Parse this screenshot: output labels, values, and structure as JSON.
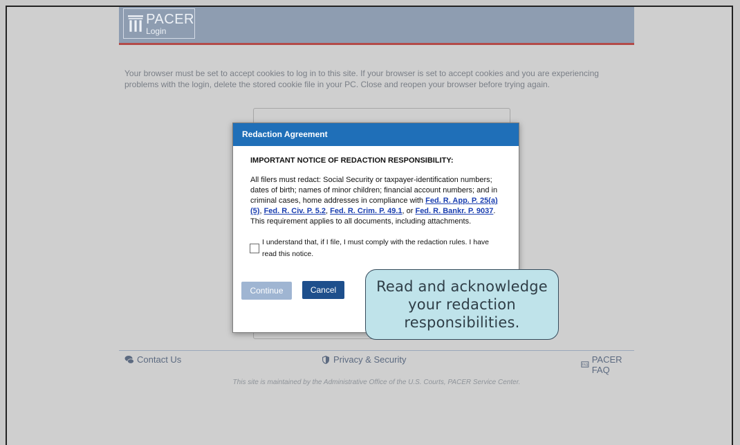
{
  "header": {
    "logo_title": "PACER",
    "logo_subtitle": "Login"
  },
  "main": {
    "cookie_notice": "Your browser must be set to accept cookies to log in to this site. If your browser is set to accept cookies and you are experiencing problems with the login, delete the stored cookie file in your PC. Close and reopen your browser before trying again."
  },
  "modal": {
    "title": "Redaction Agreement",
    "heading": "IMPORTANT NOTICE OF REDACTION RESPONSIBILITY:",
    "body_prefix": "All filers must redact: Social Security or taxpayer-identification numbers; dates of birth; names of minor children; financial account numbers; and in criminal cases, home addresses in compliance with ",
    "links": [
      "Fed. R. App. P. 25(a)(5)",
      "Fed. R. Civ. P. 5.2",
      "Fed. R. Crim. P. 49.1",
      "Fed. R. Bankr. P. 9037"
    ],
    "sep_comma": ", ",
    "sep_or": ", or ",
    "body_suffix": ". This requirement applies to all documents, including attachments.",
    "checkbox_label": "I understand that, if I file, I must comply with the redaction rules. I have read this notice.",
    "checkbox_checked": false,
    "continue_label": "Continue",
    "continue_enabled": false,
    "cancel_label": "Cancel"
  },
  "callout": {
    "text": "Read and acknowledge your redaction responsibilities."
  },
  "footer": {
    "contact_label": "Contact Us",
    "privacy_label": "Privacy & Security",
    "faq_label": "PACER FAQ",
    "maintained_note": "This site is maintained by the Administrative Office of the U.S. Courts, PACER Service Center."
  },
  "colors": {
    "modal_header": "#1f6fb8",
    "header_bar": "#8e9db1",
    "callout_bg": "#bfe3ea",
    "link": "#1b3fb0"
  }
}
